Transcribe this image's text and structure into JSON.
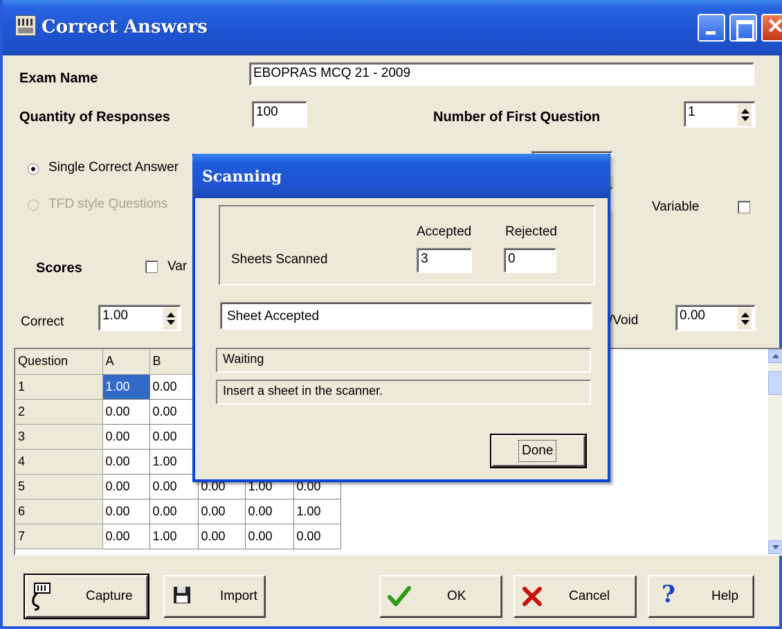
{
  "window": {
    "title": "Correct Answers"
  },
  "form": {
    "exam_name_label": "Exam Name",
    "exam_name_value": "EBOPRAS MCQ 21 - 2009",
    "quantity_label": "Quantity of Responses",
    "quantity_value": "100",
    "first_question_label": "Number of First Question",
    "first_question_value": "1",
    "single_answer_label": "Single Correct Answer",
    "tfd_label": "TFD style Questions",
    "variable_label": "Variable",
    "scores_label": "Scores",
    "scores_var_label": "Var",
    "correct_label": "Correct",
    "correct_value": "1.00",
    "void_label": "/Void",
    "void_value": "0.00"
  },
  "grid": {
    "headers": [
      "Question",
      "A",
      "B"
    ],
    "rows": [
      [
        "1",
        "1.00",
        "0.00",
        "",
        "",
        ""
      ],
      [
        "2",
        "0.00",
        "0.00",
        "",
        "",
        ""
      ],
      [
        "3",
        "0.00",
        "0.00",
        "",
        "",
        ""
      ],
      [
        "4",
        "0.00",
        "1.00",
        "",
        "",
        ""
      ],
      [
        "5",
        "0.00",
        "0.00",
        "0.00",
        "1.00",
        "0.00"
      ],
      [
        "6",
        "0.00",
        "0.00",
        "0.00",
        "0.00",
        "1.00"
      ],
      [
        "7",
        "0.00",
        "1.00",
        "0.00",
        "0.00",
        "0.00"
      ]
    ]
  },
  "buttons": {
    "capture": "Capture",
    "import": "Import",
    "ok": "OK",
    "cancel": "Cancel",
    "help": "Help"
  },
  "dialog": {
    "title": "Scanning",
    "accepted_label": "Accepted",
    "rejected_label": "Rejected",
    "sheets_scanned_label": "Sheets Scanned",
    "accepted_value": "3",
    "rejected_value": "0",
    "result_text": "Sheet Accepted",
    "status_text": "Waiting",
    "message_text": "Insert a sheet in the scanner.",
    "done_button": "Done"
  },
  "colors": {
    "titlebar": "#1e56d6",
    "selection": "#316ac5",
    "ok_check": "#2e9a1a",
    "cancel_x": "#c81010",
    "help_q": "#1a3fc8"
  }
}
